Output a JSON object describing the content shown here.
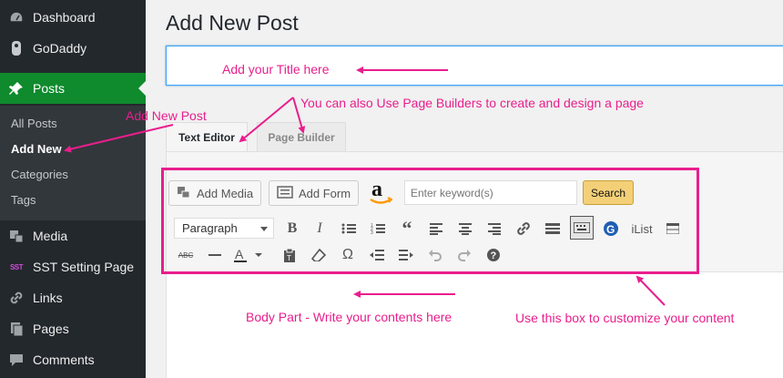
{
  "sidebar": {
    "items": [
      {
        "label": "Dashboard",
        "icon": "dashboard-icon"
      },
      {
        "label": "GoDaddy",
        "icon": "godaddy-icon"
      },
      {
        "label": "Posts",
        "icon": "pin-icon"
      },
      {
        "label": "Media",
        "icon": "media-icon"
      },
      {
        "label": "SST Setting Page",
        "icon": "sst-icon"
      },
      {
        "label": "Links",
        "icon": "link-icon"
      },
      {
        "label": "Pages",
        "icon": "pages-icon"
      },
      {
        "label": "Comments",
        "icon": "comments-icon"
      }
    ],
    "submenu": [
      "All Posts",
      "Add New",
      "Categories",
      "Tags"
    ]
  },
  "main": {
    "page_title": "Add New Post",
    "title_value": "",
    "tabs": [
      "Text Editor",
      "Page Builder"
    ],
    "toolbar": {
      "add_media": "Add Media",
      "add_form": "Add Form",
      "keyword_placeholder": "Enter keyword(s)",
      "search": "Search",
      "format": "Paragraph",
      "ilist": "iList"
    }
  },
  "annotations": {
    "title_note": "Add your Title here",
    "add_new_note": "Add New Post",
    "builder_note": "You can also Use Page Builders to create and design a page",
    "body_note": "Body Part - Write your contents here",
    "box_note": "Use this box to customize your content"
  },
  "colors": {
    "accent": "#0f8a2d",
    "annotation": "#e91e8c",
    "sidebar": "#23282d"
  }
}
